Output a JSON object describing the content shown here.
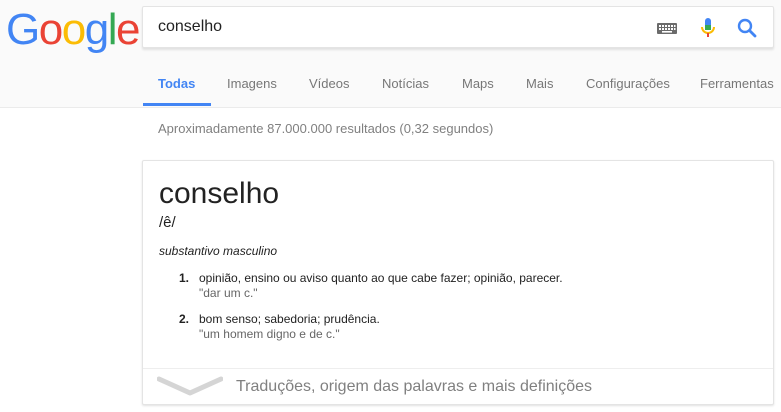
{
  "logo": {
    "letters": [
      "G",
      "o",
      "o",
      "g",
      "l",
      "e"
    ],
    "colors": [
      "#4285f4",
      "#ea4335",
      "#fbbc05",
      "#4285f4",
      "#34a853",
      "#ea4335"
    ]
  },
  "search": {
    "query": "conselho",
    "icons": [
      "keyboard-icon",
      "microphone-icon",
      "search-icon"
    ]
  },
  "tabs": [
    {
      "label": "Todas",
      "active": true
    },
    {
      "label": "Imagens",
      "active": false
    },
    {
      "label": "Vídeos",
      "active": false
    },
    {
      "label": "Notícias",
      "active": false
    },
    {
      "label": "Maps",
      "active": false
    },
    {
      "label": "Mais",
      "active": false
    },
    {
      "label": "Configurações",
      "active": false
    },
    {
      "label": "Ferramentas",
      "active": false
    }
  ],
  "results": {
    "stats": "Aproximadamente 87.000.000 resultados (0,32 segundos)"
  },
  "dictionary": {
    "word": "conselho",
    "phonetic": "/ê/",
    "part_of_speech": "substantivo masculino",
    "definitions": [
      {
        "num": "1.",
        "text": "opinião, ensino ou aviso quanto ao que cabe fazer; opinião, parecer.",
        "example": "\"dar um c.\""
      },
      {
        "num": "2.",
        "text": "bom senso; sabedoria; prudência.",
        "example": "\"um homem digno e de c.\""
      }
    ],
    "more_label": "Traduções, origem das palavras e mais definições"
  },
  "colors": {
    "accent": "#4285f4",
    "tab_inactive": "#777777",
    "muted_text": "#808080"
  }
}
